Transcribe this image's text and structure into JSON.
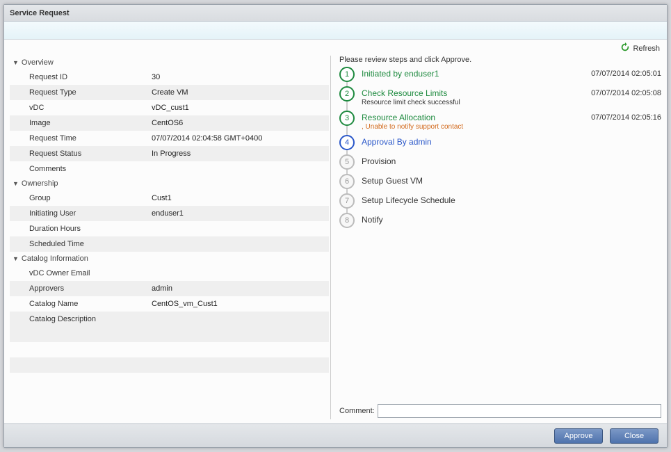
{
  "header": {
    "title": "Service Request"
  },
  "refresh": {
    "label": "Refresh"
  },
  "sections": {
    "overview": {
      "title": "Overview",
      "request_id": {
        "label": "Request ID",
        "value": "30"
      },
      "request_type": {
        "label": "Request Type",
        "value": "Create VM"
      },
      "vdc": {
        "label": "vDC",
        "value": "vDC_cust1"
      },
      "image": {
        "label": "Image",
        "value": "CentOS6"
      },
      "request_time": {
        "label": "Request Time",
        "value": "07/07/2014 02:04:58 GMT+0400"
      },
      "request_status": {
        "label": "Request Status",
        "value": "In Progress"
      },
      "comments": {
        "label": "Comments",
        "value": ""
      }
    },
    "ownership": {
      "title": "Ownership",
      "group": {
        "label": "Group",
        "value": "Cust1"
      },
      "initiating_user": {
        "label": "Initiating User",
        "value": "enduser1"
      },
      "duration_hours": {
        "label": "Duration Hours",
        "value": ""
      },
      "scheduled_time": {
        "label": "Scheduled Time",
        "value": ""
      }
    },
    "catalog": {
      "title": "Catalog Information",
      "vdc_owner_email": {
        "label": "vDC Owner Email",
        "value": ""
      },
      "approvers": {
        "label": "Approvers",
        "value": "admin"
      },
      "catalog_name": {
        "label": "Catalog Name",
        "value": "CentOS_vm_Cust1"
      },
      "catalog_description": {
        "label": "Catalog Description",
        "value": ""
      }
    }
  },
  "steps": {
    "intro": "Please review steps and click Approve.",
    "items": [
      {
        "num": "1",
        "title": "Initiated by enduser1",
        "sub": "",
        "ts": "07/07/2014 02:05:01",
        "state": "done"
      },
      {
        "num": "2",
        "title": "Check Resource Limits",
        "sub": "Resource limit check successful",
        "ts": "07/07/2014 02:05:08",
        "state": "done"
      },
      {
        "num": "3",
        "title": "Resource Allocation",
        "sub": ", Unable to notify support contact",
        "ts": "07/07/2014 02:05:16",
        "state": "warn"
      },
      {
        "num": "4",
        "title": "Approval By admin",
        "sub": "",
        "ts": "",
        "state": "active"
      },
      {
        "num": "5",
        "title": "Provision",
        "sub": "",
        "ts": "",
        "state": "pending"
      },
      {
        "num": "6",
        "title": "Setup Guest VM",
        "sub": "",
        "ts": "",
        "state": "pending"
      },
      {
        "num": "7",
        "title": "Setup Lifecycle Schedule",
        "sub": "",
        "ts": "",
        "state": "pending"
      },
      {
        "num": "8",
        "title": "Notify",
        "sub": "",
        "ts": "",
        "state": "pending"
      }
    ]
  },
  "comment": {
    "label": "Comment:",
    "value": ""
  },
  "footer": {
    "approve": "Approve",
    "close": "Close"
  }
}
